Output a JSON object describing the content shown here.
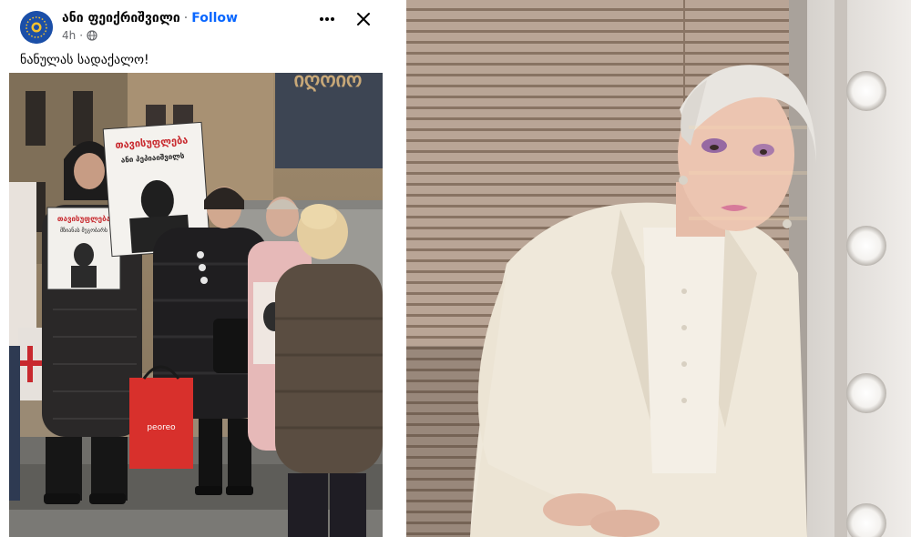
{
  "post": {
    "author": "ანი ფეიქრიშვილი",
    "separator": "·",
    "follow_label": "Follow",
    "time": "4h",
    "text": "ნანულას სადაქალო!",
    "icons": {
      "avatar": "party-logo-avatar",
      "privacy": "globe-icon",
      "more": "more-options-icon",
      "close": "close-icon"
    }
  },
  "images": {
    "left": {
      "sign_top": "იღოიო",
      "placard_1_line_1": "თავისუფლება",
      "placard_1_line_2": "ანი პეპიაიშვილს",
      "placard_2_line_1": "თავისუფლება",
      "placard_2_line_2": "მზიანას მეგობარს",
      "bag_label": "peoreo"
    },
    "right": {}
  },
  "colors": {
    "link": "#0866ff",
    "text": "#050505",
    "muted": "#65676b",
    "avatar_bg": "#1b4fa8"
  }
}
